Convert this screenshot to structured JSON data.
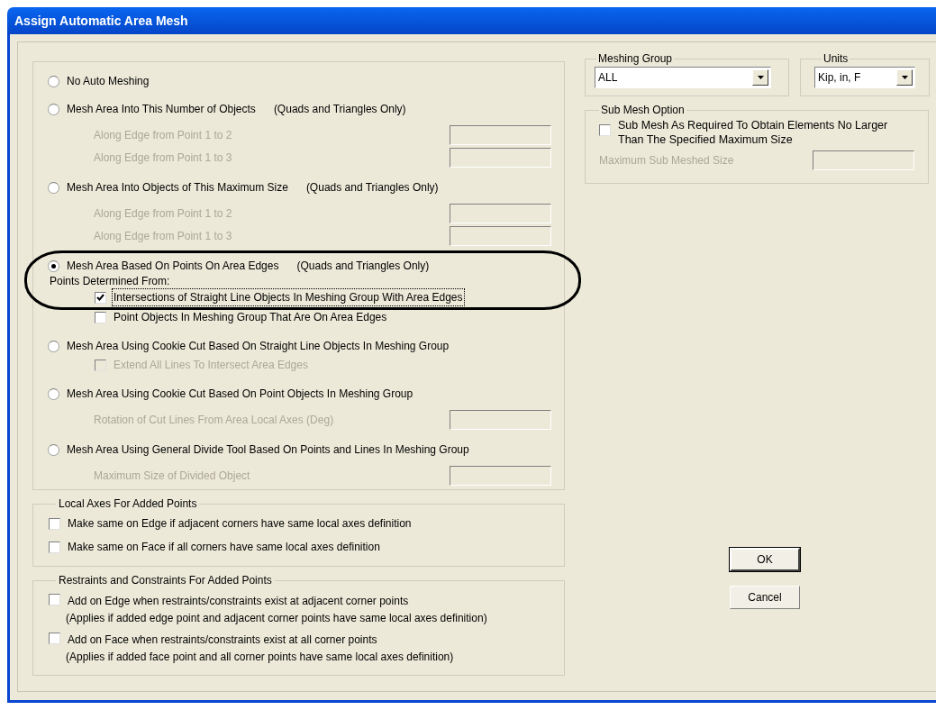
{
  "window": {
    "title": "Assign Automatic Area Mesh"
  },
  "mesh_options": [
    {
      "label": "No Auto Meshing",
      "selected": false
    },
    {
      "label": "Mesh Area Into This Number of Objects",
      "note": "(Quads and Triangles Only)",
      "selected": false,
      "items": [
        {
          "kind": "field",
          "label": "Along Edge from Point 1 to 2",
          "disabled": true
        },
        {
          "kind": "field",
          "label": "Along Edge from Point 1 to 3",
          "disabled": true
        }
      ]
    },
    {
      "label": "Mesh Area Into Objects of This Maximum Size",
      "note": "(Quads and Triangles Only)",
      "selected": false,
      "items": [
        {
          "kind": "field",
          "label": "Along Edge from Point 1 to 2",
          "disabled": true
        },
        {
          "kind": "field",
          "label": "Along Edge from Point 1 to 3",
          "disabled": true
        }
      ]
    },
    {
      "label": "Mesh Area Based On Points On Area Edges",
      "note": "(Quads and Triangles Only)",
      "selected": true,
      "items": [
        {
          "kind": "caption",
          "label": "Points Determined From:"
        },
        {
          "kind": "checkbox",
          "label": "Intersections of Straight Line Objects In Meshing Group With Area Edges",
          "checked": true,
          "disabled": false,
          "focused": true
        },
        {
          "kind": "checkbox",
          "label": "Point Objects In Meshing Group That Are On Area Edges",
          "checked": false,
          "disabled": false,
          "focused": false
        }
      ]
    },
    {
      "label": "Mesh Area Using Cookie Cut Based On Straight Line Objects In Meshing Group",
      "selected": false,
      "items": [
        {
          "kind": "checkbox",
          "label": "Extend All Lines To Intersect Area Edges",
          "checked": false,
          "disabled": true,
          "focused": false
        }
      ]
    },
    {
      "label": "Mesh Area Using Cookie Cut Based On Point Objects In Meshing Group",
      "selected": false,
      "items": [
        {
          "kind": "field",
          "label": "Rotation of Cut Lines From Area Local Axes (Deg)",
          "disabled": true
        }
      ]
    },
    {
      "label": "Mesh Area Using General Divide Tool Based On  Points and Lines In Meshing Group",
      "selected": false,
      "items": [
        {
          "kind": "field",
          "label": "Maximum Size of Divided Object",
          "disabled": true
        }
      ]
    }
  ],
  "local_axes": {
    "title": "Local Axes For Added Points",
    "checkboxes": [
      {
        "label": "Make same on Edge if adjacent corners have same local axes definition",
        "checked": false
      },
      {
        "label": "Make same on Face if all corners have same local axes definition",
        "checked": false
      }
    ]
  },
  "restraints": {
    "title": "Restraints and Constraints For Added Points",
    "checkboxes": [
      {
        "label": "Add on Edge when restraints/constraints exist at adjacent corner points",
        "note": "(Applies if added edge point and adjacent corner points have same local axes definition)",
        "checked": false
      },
      {
        "label": "Add on Face when restraints/constraints exist at all corner points",
        "note": "(Applies if added face point and all corner points have same local axes definition)",
        "checked": false
      }
    ]
  },
  "meshing_group": {
    "label": "Meshing Group",
    "value": "ALL"
  },
  "units": {
    "label": "Units",
    "value": "Kip, in, F"
  },
  "sub_mesh": {
    "title": "Sub Mesh Option",
    "checkbox": {
      "label": "Sub Mesh As Required To Obtain Elements No Larger Than The Specified Maximum Size",
      "checked": false
    },
    "field": {
      "label": "Maximum Sub Meshed Size",
      "disabled": true
    }
  },
  "buttons": [
    {
      "label": "OK",
      "default": true
    },
    {
      "label": "Cancel",
      "default": false
    }
  ]
}
